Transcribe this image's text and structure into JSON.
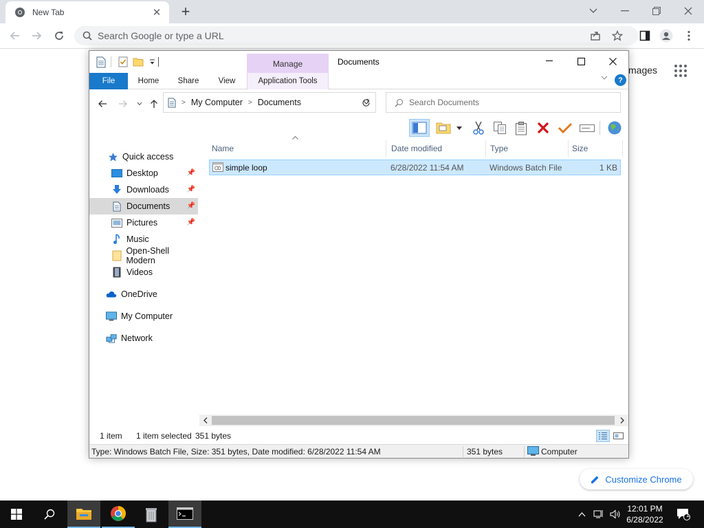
{
  "browser": {
    "tab_title": "New Tab",
    "omnibox_placeholder": "Search Google or type a URL",
    "ntp_images_link": "mages",
    "customize_label": "Customize Chrome"
  },
  "explorer": {
    "title": "Documents",
    "context_tab_group": "Manage",
    "ribbon_tabs": [
      "File",
      "Home",
      "Share",
      "View",
      "Application Tools"
    ],
    "address": {
      "crumbs": [
        "My Computer",
        "Documents"
      ]
    },
    "search_placeholder": "Search Documents",
    "nav": {
      "quick_access": "Quick access",
      "items": [
        "Desktop",
        "Downloads",
        "Documents",
        "Pictures",
        "Music",
        "Open-Shell Modern",
        "Videos"
      ],
      "onedrive": "OneDrive",
      "my_computer": "My Computer",
      "network": "Network"
    },
    "columns": [
      "Name",
      "Date modified",
      "Type",
      "Size"
    ],
    "files": [
      {
        "name": "simple loop",
        "date": "6/28/2022 11:54 AM",
        "type": "Windows Batch File",
        "size": "1 KB"
      }
    ],
    "status": {
      "count": "1 item",
      "selected": "1 item selected",
      "bytes": "351 bytes"
    },
    "details": {
      "summary": "Type: Windows Batch File, Size: 351 bytes, Date modified: 6/28/2022 11:54 AM",
      "size": "351 bytes",
      "location": "Computer"
    }
  },
  "taskbar": {
    "time": "12:01 PM",
    "date": "6/28/2022",
    "notification_count": "1"
  },
  "colors": {
    "file_tab": "#1979ca",
    "manage_tab": "#e6d2f5",
    "selection": "#cce8ff",
    "taskbar": "#101010"
  },
  "icons": [
    "chrome-icon",
    "search-icon",
    "share-icon",
    "star-icon",
    "side-panel-icon",
    "profile-icon",
    "menu-icon",
    "apps-grid-icon",
    "pencil-icon",
    "folder-icon",
    "cut-icon",
    "copy-icon",
    "paste-icon",
    "delete-icon",
    "check-icon",
    "rename-icon",
    "globe-icon",
    "start-icon",
    "file-explorer-icon",
    "terminal-icon"
  ]
}
